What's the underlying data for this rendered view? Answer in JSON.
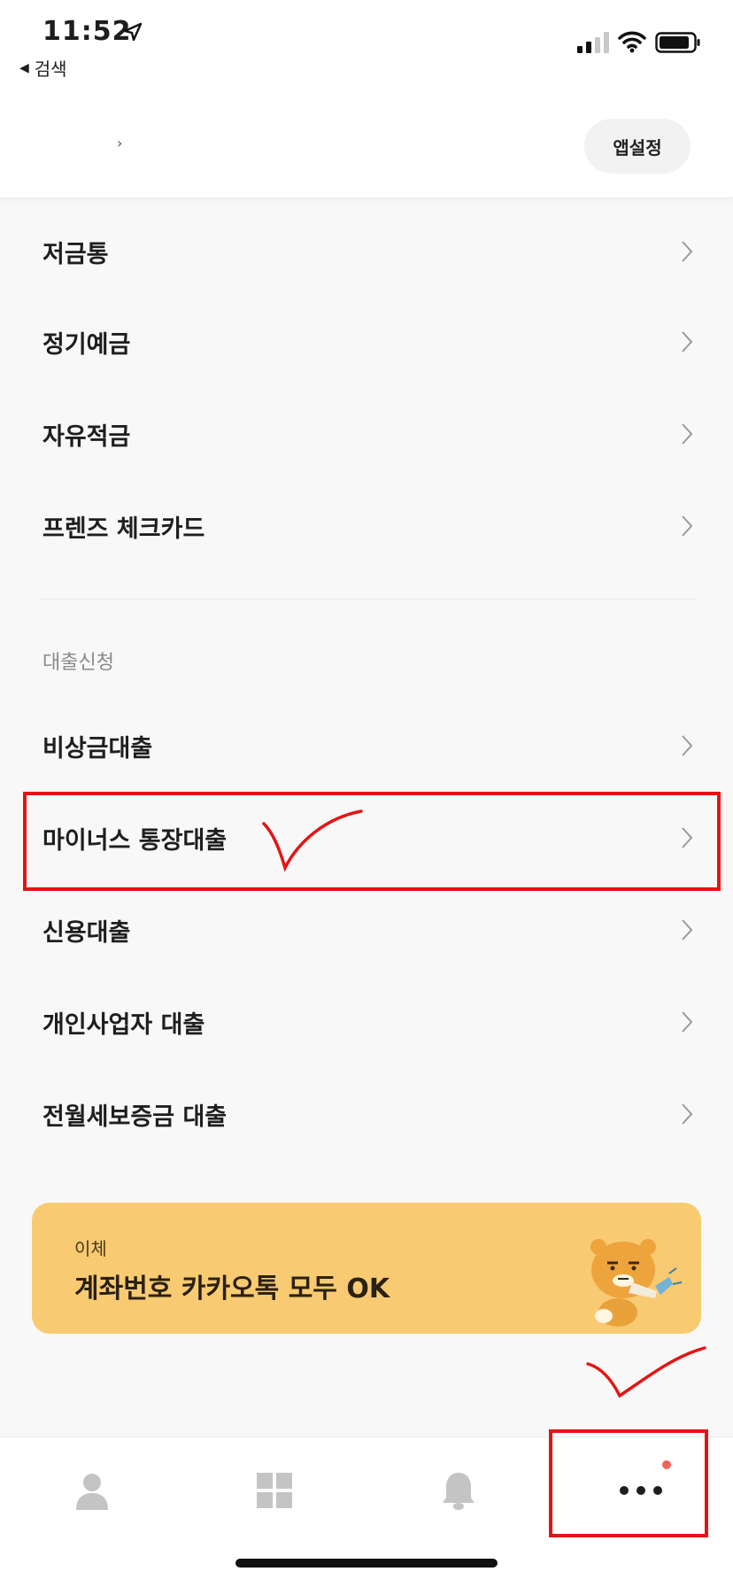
{
  "status_bar": {
    "time": "11:52",
    "back_label": "검색"
  },
  "header": {
    "app_settings_label": "앱설정"
  },
  "menu": {
    "items": [
      {
        "label": "저금통"
      },
      {
        "label": "정기예금"
      },
      {
        "label": "자유적금"
      },
      {
        "label": "프렌즈 체크카드"
      }
    ],
    "loan_section_title": "대출신청",
    "loan_items": [
      {
        "label": "비상금대출"
      },
      {
        "label": "마이너스 통장대출"
      },
      {
        "label": "신용대출"
      },
      {
        "label": "개인사업자 대출"
      },
      {
        "label": "전월세보증금 대출"
      }
    ]
  },
  "banner": {
    "small_text": "이체",
    "big_text": "계좌번호 카카오톡 모두 OK"
  },
  "tabbar": {
    "tabs": [
      "person-icon",
      "grid-icon",
      "bell-icon",
      "more-icon"
    ],
    "active_tab": "more-icon",
    "badge_color": "#f0635b"
  },
  "colors": {
    "banner": "#f8ca72",
    "annotation": "#e41414",
    "background": "#f8f8f8"
  }
}
